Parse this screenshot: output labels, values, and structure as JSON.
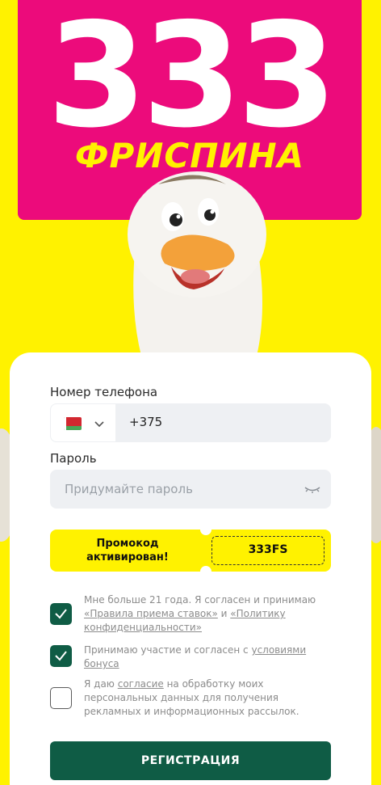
{
  "hero": {
    "number": "333",
    "word": "ФРИСПИНА"
  },
  "form": {
    "phone_label": "Номер телефона",
    "phone_value": "+375",
    "country_flag": "belarus-flag-icon",
    "password_label": "Пароль",
    "password_placeholder": "Придумайте пароль",
    "promo": {
      "title_line1": "Промокод",
      "title_line2": "активирован!",
      "code": "333FS"
    },
    "consents": [
      {
        "checked": true,
        "text_before": "Мне больше 21 года. Я согласен и принимаю ",
        "link1": "«Правила приема ставок»",
        "middle": " и ",
        "link2": "«Политику конфиденциальности»"
      },
      {
        "checked": true,
        "text_before": "Принимаю участие и согласен с ",
        "link1": "условиями бонуса"
      },
      {
        "checked": false,
        "text_before": "Я даю ",
        "link1": "согласие",
        "text_after": " на обработку моих персональных данных для получения рекламных и информационных рассылок."
      }
    ],
    "submit_label": "РЕГИСТРАЦИЯ"
  },
  "colors": {
    "background": "#fff200",
    "board": "#ec0b7b",
    "accent": "#0f5c45"
  }
}
